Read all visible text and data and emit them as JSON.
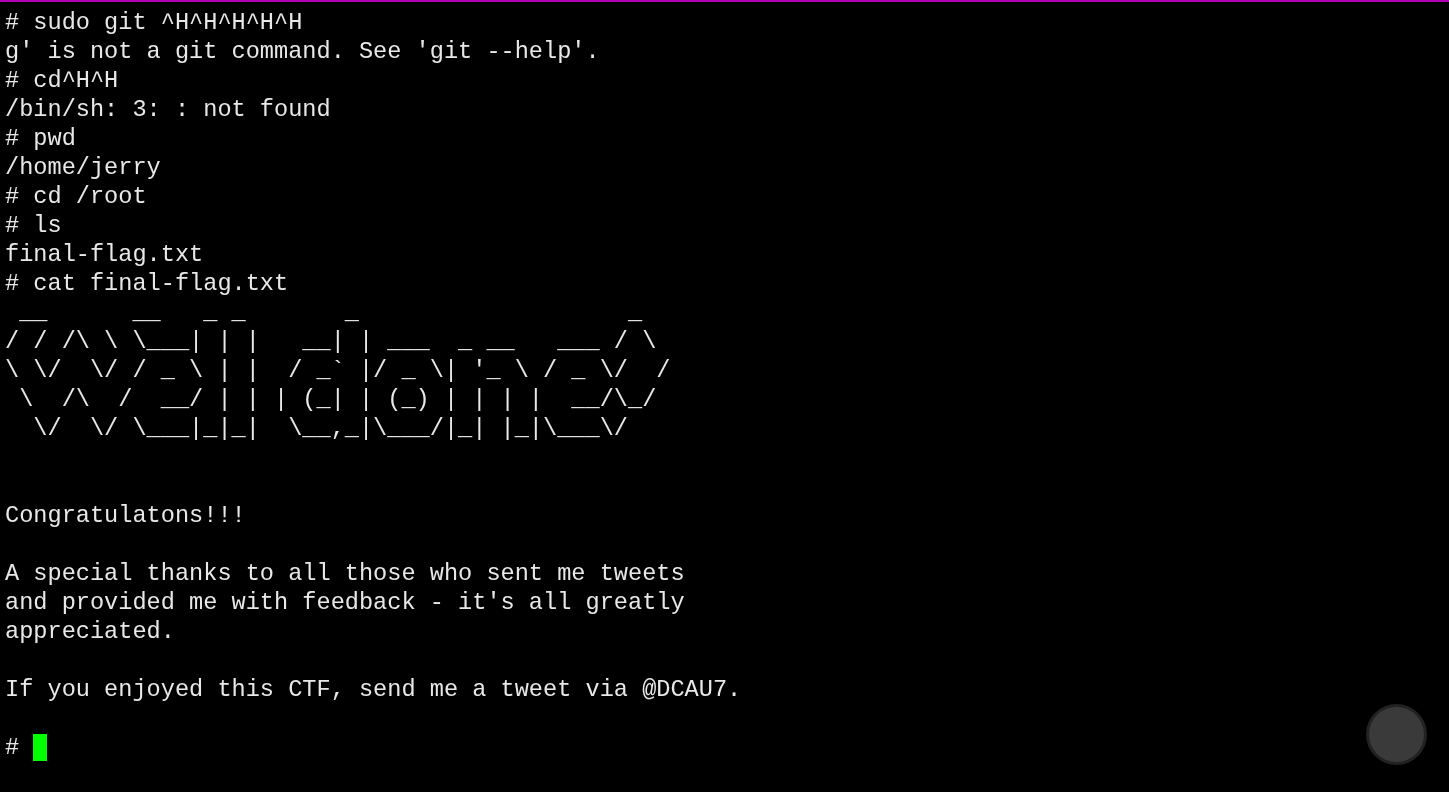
{
  "terminal": {
    "lines": [
      {
        "kind": "line",
        "text": "# sudo git ^H^H^H^H^H"
      },
      {
        "kind": "line",
        "text": "g' is not a git command. See 'git --help'."
      },
      {
        "kind": "line",
        "text": "# cd^H^H"
      },
      {
        "kind": "line",
        "text": "/bin/sh: 3: : not found"
      },
      {
        "kind": "line",
        "text": "# pwd"
      },
      {
        "kind": "line",
        "text": "/home/jerry"
      },
      {
        "kind": "line",
        "text": "# cd /root"
      },
      {
        "kind": "line",
        "text": "# ls"
      },
      {
        "kind": "line",
        "text": "final-flag.txt"
      },
      {
        "kind": "line",
        "text": "# cat final-flag.txt"
      },
      {
        "kind": "art",
        "rows": [
          " __      __   _ _       _                   _ ",
          "/ / /\\ \\ \\___| | |   __| | ___  _ __   ___ / \\",
          "\\ \\/  \\/ / _ \\ | |  / _` |/ _ \\| '_ \\ / _ \\/  /",
          " \\  /\\  /  __/ | | | (_| | (_) | | | |  __/\\_/ ",
          "  \\/  \\/ \\___|_|_|  \\__,_|\\___/|_| |_|\\___\\/  "
        ]
      },
      {
        "kind": "blank"
      },
      {
        "kind": "blank"
      },
      {
        "kind": "line",
        "text": "Congratulatons!!!"
      },
      {
        "kind": "blank"
      },
      {
        "kind": "line",
        "text": "A special thanks to all those who sent me tweets"
      },
      {
        "kind": "line",
        "text": "and provided me with feedback - it's all greatly"
      },
      {
        "kind": "line",
        "text": "appreciated."
      },
      {
        "kind": "blank"
      },
      {
        "kind": "line",
        "text": "If you enjoyed this CTF, send me a tweet via @DCAU7."
      },
      {
        "kind": "blank"
      }
    ],
    "prompt": {
      "text": "#",
      "cursor": true
    }
  }
}
